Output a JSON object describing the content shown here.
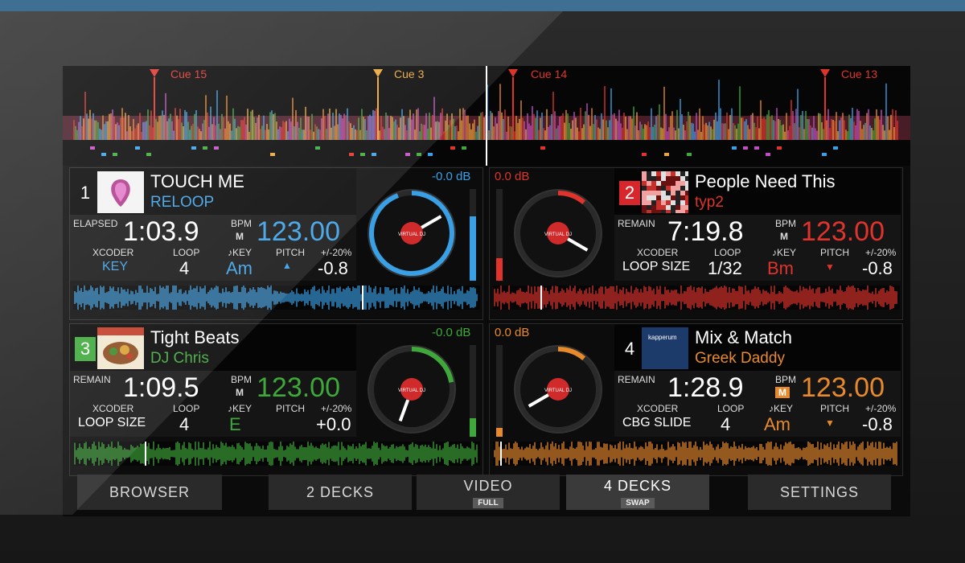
{
  "cues": [
    {
      "label": "Cue 15",
      "color": "#e0332c"
    },
    {
      "label": "Cue 3",
      "color": "#e9a53a"
    },
    {
      "label": "Cue 14",
      "color": "#e0332c"
    },
    {
      "label": "Cue 13",
      "color": "#e0332c"
    }
  ],
  "decks": [
    {
      "number": "1",
      "title": "TOUCH ME",
      "artist": "RELOOP",
      "accent": "#3aa0e6",
      "number_bg": "transparent",
      "time_label": "ELAPSED",
      "time": "1:03.9",
      "bpm_label": "BPM",
      "bpm_mode": "M",
      "bpm": "123.00",
      "label1": "XCODER",
      "value1": "KEY",
      "loop_label": "LOOP",
      "loop_value": "4",
      "key_label": "♪KEY",
      "key_value": "Am",
      "pitch_label": "PITCH",
      "pitch_arrow": "▲",
      "range_label": "+/-20%",
      "pitch_value": "-0.8",
      "db": "-0.0 dB",
      "art": "touchme-art",
      "level": 0.7
    },
    {
      "number": "2",
      "title": "People Need This",
      "artist": "typ2",
      "accent": "#e0332c",
      "number_bg": "#d8272c",
      "time_label": "REMAIN",
      "time": "7:19.8",
      "bpm_label": "BPM",
      "bpm_mode": "M",
      "bpm": "123.00",
      "label1": "LOOP SIZE",
      "value1": "",
      "loop_label": "LOOP",
      "loop_value": "1/32",
      "key_label": "♪KEY",
      "key_value": "Bm",
      "pitch_label": "PITCH",
      "pitch_arrow": "▼",
      "range_label": "+/-20%",
      "pitch_value": "-0.8",
      "xcoder_label": "XCODER",
      "db": "0.0 dB",
      "art": "peopleneed-art",
      "level": 0.25
    },
    {
      "number": "3",
      "title": "Tight Beats",
      "artist": "DJ Chris",
      "accent": "#3ea83a",
      "number_bg": "#3ea83a",
      "time_label": "REMAIN",
      "time": "1:09.5",
      "bpm_label": "BPM",
      "bpm_mode": "M",
      "bpm": "123.00",
      "label1": "XCODER",
      "value1": "LOOP SIZE",
      "loop_label": "LOOP",
      "loop_value": "4",
      "key_label": "♪KEY",
      "key_value": "E",
      "pitch_label": "PITCH",
      "pitch_arrow": "",
      "range_label": "+/-20%",
      "pitch_value": "+0.0",
      "db": "-0.0 dB",
      "art": "tightbeats-art",
      "level": 0.2
    },
    {
      "number": "4",
      "title": "Mix & Match",
      "artist": "Greek Daddy",
      "accent": "#e88a2c",
      "number_bg": "transparent",
      "time_label": "REMAIN",
      "time": "1:28.9",
      "bpm_label": "BPM",
      "bpm_mode": "M",
      "bpm": "123.00",
      "label1": "XCODER",
      "value1": "CBG SLIDE",
      "loop_label": "LOOP",
      "loop_value": "4",
      "key_label": "♪KEY",
      "key_value": "Am",
      "pitch_label": "PITCH",
      "pitch_arrow": "▼",
      "range_label": "+/-20%",
      "pitch_value": "-0.8",
      "db": "0.0 dB",
      "art": "mixmatch-art",
      "art_text": "kapperum",
      "level": 0.1
    }
  ],
  "buttons": [
    {
      "label": "BROWSER",
      "sub": ""
    },
    {
      "label": "2 DECKS",
      "sub": ""
    },
    {
      "label": "VIDEO",
      "sub": "FULL"
    },
    {
      "label": "4 DECKS",
      "sub": "SWAP"
    },
    {
      "label": "SETTINGS",
      "sub": ""
    }
  ],
  "vinyl_label": "VIRTUAL DJ"
}
